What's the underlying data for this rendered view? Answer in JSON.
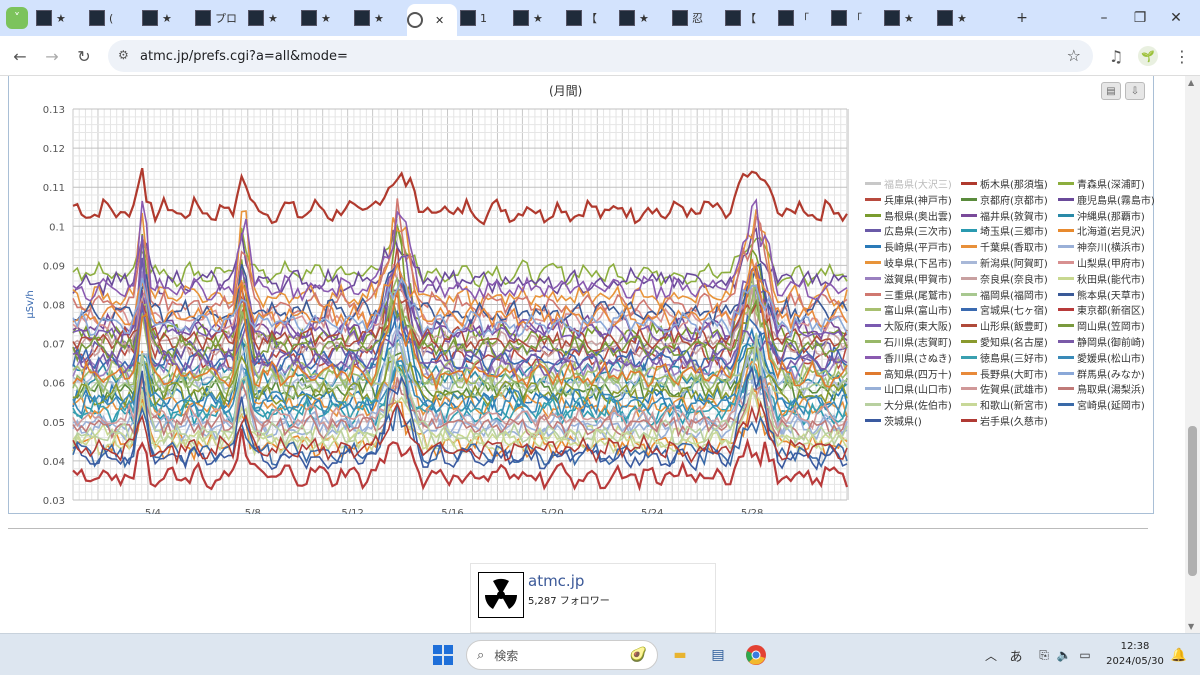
{
  "browser": {
    "tabs": [
      "★",
      "(",
      "★",
      "プロ",
      "★",
      "★",
      "★",
      "",
      "1",
      "★",
      "【",
      "★",
      "忍",
      "【",
      "「",
      "「",
      "★",
      "★"
    ],
    "url": "atmc.jp/prefs.cgi?a=all&mode="
  },
  "chart": {
    "title": "(月間)",
    "ylabel": "μSv/h",
    "print_icon": "printer-icon",
    "download_icon": "download-icon"
  },
  "chart_data": {
    "type": "line",
    "title": "(月間)",
    "ylabel": "μSv/h",
    "xlabel": "",
    "ylim": [
      0.03,
      0.13
    ],
    "yticks": [
      "0.13",
      "0.12",
      "0.11",
      "0.1",
      "0.09",
      "0.08",
      "0.07",
      "0.06",
      "0.05",
      "0.04",
      "0.03"
    ],
    "xticks": [
      "5/4",
      "5/8",
      "5/12",
      "5/16",
      "5/20",
      "5/24",
      "5/28"
    ],
    "grid": true,
    "legend_position": "right",
    "series": [
      {
        "name": "福島県(大沢三)",
        "color": "#c8c8c8",
        "baseline": 0.0
      },
      {
        "name": "栃木県(那須塩)",
        "color": "#b03a2e",
        "baseline": 0.104
      },
      {
        "name": "青森県(深浦町)",
        "color": "#8cae3e",
        "baseline": 0.088
      },
      {
        "name": "兵庫県(神戸市)",
        "color": "#b84a3e",
        "baseline": 0.067
      },
      {
        "name": "京都府(京都市)",
        "color": "#5a8b3c",
        "baseline": 0.058
      },
      {
        "name": "鹿児島県(霧島市)",
        "color": "#6a4a9a",
        "baseline": 0.086
      },
      {
        "name": "島根県(奥出雲)",
        "color": "#7a9c2e",
        "baseline": 0.072
      },
      {
        "name": "福井県(敦賀市)",
        "color": "#7a4a9a",
        "baseline": 0.074
      },
      {
        "name": "沖縄県(那覇市)",
        "color": "#2a8aa8",
        "baseline": 0.062
      },
      {
        "name": "広島県(三次市)",
        "color": "#6a5aa8",
        "baseline": 0.068
      },
      {
        "name": "埼玉県(三郷市)",
        "color": "#2a9ab0",
        "baseline": 0.052
      },
      {
        "name": "北海道(岩見沢)",
        "color": "#e88a2e",
        "baseline": 0.044
      },
      {
        "name": "長崎県(平戸市)",
        "color": "#2a7ab8",
        "baseline": 0.056
      },
      {
        "name": "千葉県(香取市)",
        "color": "#e8903a",
        "baseline": 0.054
      },
      {
        "name": "神奈川(横浜市)",
        "color": "#9ab0d8",
        "baseline": 0.05
      },
      {
        "name": "岐阜県(下呂市)",
        "color": "#e8943a",
        "baseline": 0.082
      },
      {
        "name": "新潟県(阿賀町)",
        "color": "#a8b8d8",
        "baseline": 0.06
      },
      {
        "name": "山梨県(甲府市)",
        "color": "#d89090",
        "baseline": 0.076
      },
      {
        "name": "滋賀県(甲賀市)",
        "color": "#9a80c0",
        "baseline": 0.064
      },
      {
        "name": "奈良県(奈良市)",
        "color": "#c8a0a0",
        "baseline": 0.07
      },
      {
        "name": "秋田県(能代市)",
        "color": "#c8d890",
        "baseline": 0.046
      },
      {
        "name": "三重県(尾鷲市)",
        "color": "#d07870",
        "baseline": 0.08
      },
      {
        "name": "福岡県(福岡市)",
        "color": "#a8c890",
        "baseline": 0.059
      },
      {
        "name": "熊本県(天草市)",
        "color": "#3a5a98",
        "baseline": 0.078
      },
      {
        "name": "富山県(富山市)",
        "color": "#a8c070",
        "baseline": 0.063
      },
      {
        "name": "宮城県(七ヶ宿)",
        "color": "#3a6ab0",
        "baseline": 0.066
      },
      {
        "name": "東京都(新宿区)",
        "color": "#b83a3a",
        "baseline": 0.036
      },
      {
        "name": "大阪府(東大阪)",
        "color": "#7a5ab0",
        "baseline": 0.073
      },
      {
        "name": "山形県(飯豊町)",
        "color": "#b04a3a",
        "baseline": 0.071
      },
      {
        "name": "岡山県(笠岡市)",
        "color": "#7a9a3e",
        "baseline": 0.069
      },
      {
        "name": "石川県(志賀町)",
        "color": "#98b868",
        "baseline": 0.061
      },
      {
        "name": "愛知県(名古屋)",
        "color": "#8a9a2e",
        "baseline": 0.057
      },
      {
        "name": "静岡県(御前崎)",
        "color": "#7a5aa8",
        "baseline": 0.065
      },
      {
        "name": "香川県(さぬき)",
        "color": "#8a5ab0",
        "baseline": 0.084
      },
      {
        "name": "徳島県(三好市)",
        "color": "#3aa0b0",
        "baseline": 0.053
      },
      {
        "name": "愛媛県(松山市)",
        "color": "#3a8ab8",
        "baseline": 0.055
      },
      {
        "name": "高知県(四万十)",
        "color": "#e07a2e",
        "baseline": 0.062
      },
      {
        "name": "長野県(大町市)",
        "color": "#e88a3a",
        "baseline": 0.077
      },
      {
        "name": "群馬県(みなか)",
        "color": "#8aa8d8",
        "baseline": 0.075
      },
      {
        "name": "山口県(山口市)",
        "color": "#98b0d8",
        "baseline": 0.048
      },
      {
        "name": "佐賀県(武雄市)",
        "color": "#d09898",
        "baseline": 0.051
      },
      {
        "name": "鳥取県(湯梨浜)",
        "color": "#c07a78",
        "baseline": 0.049
      },
      {
        "name": "大分県(佐伯市)",
        "color": "#b8d0a0",
        "baseline": 0.047
      },
      {
        "name": "和歌山(新宮市)",
        "color": "#c8d898",
        "baseline": 0.045
      },
      {
        "name": "宮崎県(延岡市)",
        "color": "#3a6aa8",
        "baseline": 0.042
      },
      {
        "name": "茨城県()",
        "color": "#3a5aa0",
        "baseline": 0.041
      },
      {
        "name": "岩手県(久慈市)",
        "color": "#b03a34",
        "baseline": 0.043
      }
    ]
  },
  "facebook": {
    "name": "atmc.jp",
    "followers": "5,287 フォロワー"
  },
  "taskbar": {
    "search_placeholder": "検索",
    "time": "12:38",
    "date": "2024/05/30",
    "ime": "あ"
  }
}
